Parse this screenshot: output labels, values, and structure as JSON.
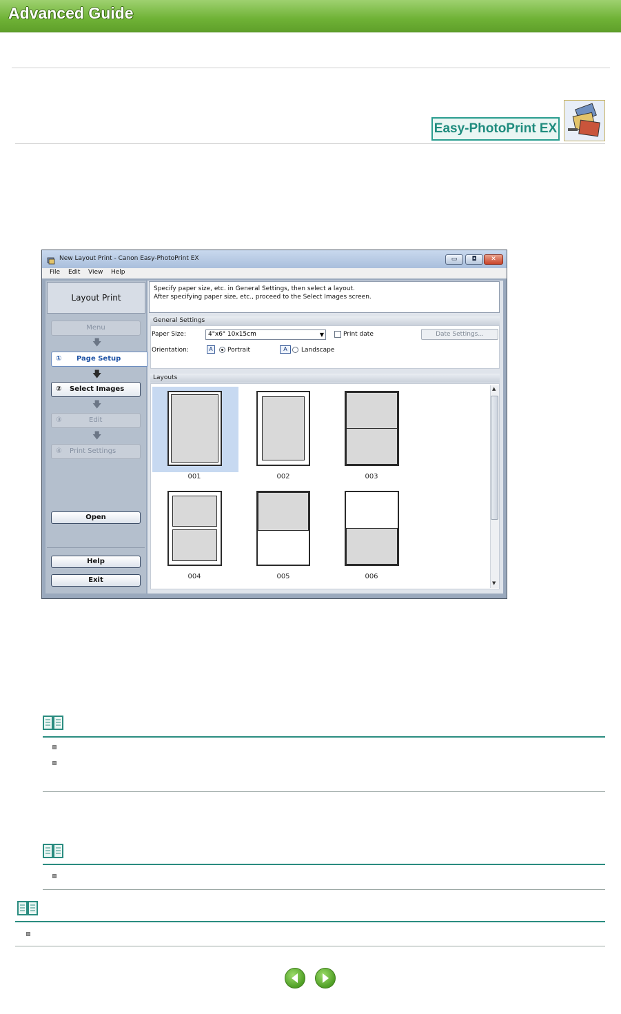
{
  "header": {
    "title": "Advanced Guide"
  },
  "product": {
    "logo_text": "Easy-PhotoPrint EX",
    "icon": "photo-stack-icon"
  },
  "window": {
    "title": "New Layout Print - Canon Easy-PhotoPrint EX",
    "controls": [
      "minimize-icon",
      "maximize-icon",
      "close-icon"
    ],
    "menu": [
      "File",
      "Edit",
      "View",
      "Help"
    ]
  },
  "sidebar": {
    "header": "Layout Print",
    "menu_label": "Menu",
    "steps": [
      {
        "num": "①",
        "label": "Page Setup",
        "state": "active"
      },
      {
        "num": "②",
        "label": "Select Images",
        "state": "enabled"
      },
      {
        "num": "③",
        "label": "Edit",
        "state": "disabled"
      },
      {
        "num": "④",
        "label": "Print Settings",
        "state": "disabled"
      }
    ],
    "open_label": "Open",
    "help_label": "Help",
    "exit_label": "Exit"
  },
  "instructions": {
    "line1": "Specify paper size, etc. in General Settings, then select a layout.",
    "line2": "After specifying paper size, etc., proceed to the Select Images screen."
  },
  "general_settings": {
    "heading": "General Settings",
    "paper_size_label": "Paper Size:",
    "paper_size_value": "4\"x6\" 10x15cm",
    "print_date_label": "Print date",
    "print_date_checked": false,
    "date_settings_label": "Date Settings...",
    "orientation_label": "Orientation:",
    "portrait_label": "Portrait",
    "landscape_label": "Landscape",
    "orientation_selected": "Portrait",
    "orientation_icon_glyph": "A"
  },
  "layouts": {
    "heading": "Layouts",
    "items": [
      "001",
      "002",
      "003",
      "004",
      "005",
      "006"
    ],
    "selected": "001"
  },
  "colors": {
    "banner": "#6fb236",
    "accent": "#2a8c80",
    "selection": "#c7d9f1"
  }
}
